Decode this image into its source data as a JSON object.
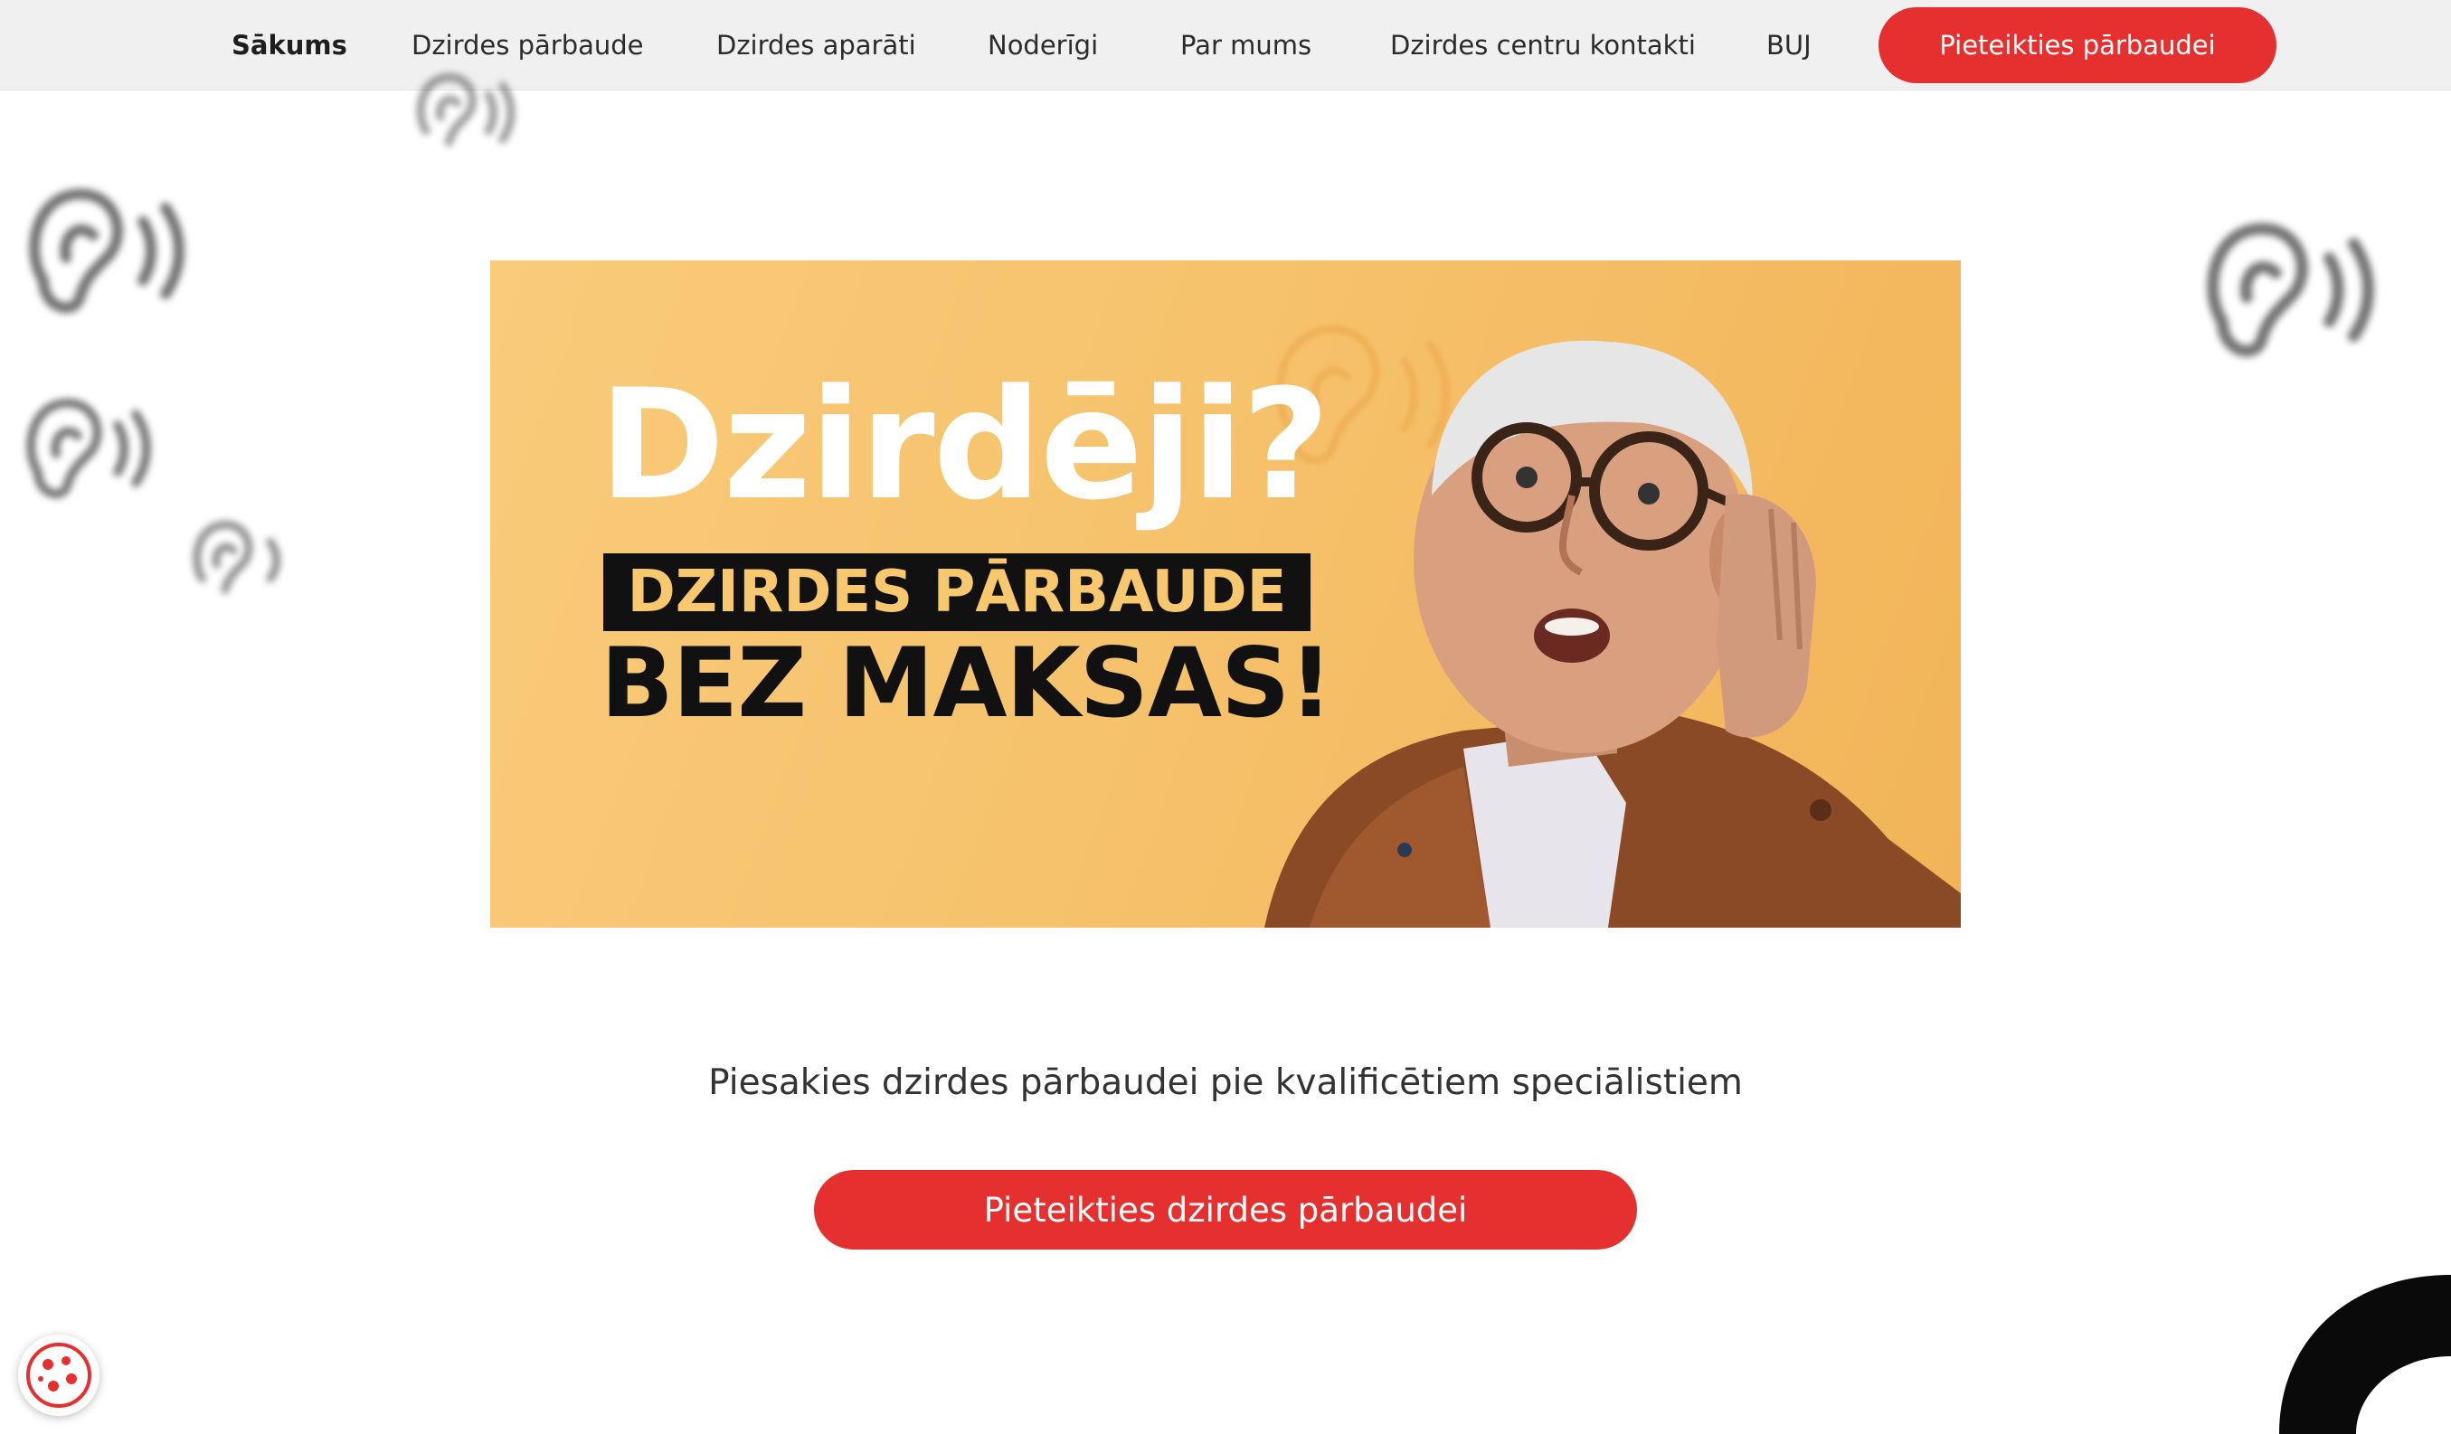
{
  "nav": {
    "items": [
      {
        "label": "Sākums",
        "active": true
      },
      {
        "label": "Dzirdes pārbaude",
        "active": false
      },
      {
        "label": "Dzirdes aparāti",
        "active": false
      },
      {
        "label": "Noderīgi",
        "active": false
      },
      {
        "label": "Par mums",
        "active": false
      },
      {
        "label": "Dzirdes centru kontakti",
        "active": false
      },
      {
        "label": "BUJ",
        "active": false
      }
    ],
    "cta_label": "Pieteikties pārbaudei"
  },
  "banner": {
    "headline": "Dzirdēji?",
    "subheadline": "DZIRDES PĀRBAUDE",
    "free_text": "BEZ MAKSAS!"
  },
  "main": {
    "tagline": "Piesakies dzirdes pārbaudei pie kvalificētiem speciālistiem",
    "cta_label": "Pieteikties dzirdes pārbaudei"
  },
  "icons": {
    "decor": "ear-sound-icon",
    "cookie": "cookie-icon"
  },
  "colors": {
    "accent": "#e6302f",
    "nav_bg": "#f0f0f0",
    "banner_bg": "#f7c46e"
  }
}
